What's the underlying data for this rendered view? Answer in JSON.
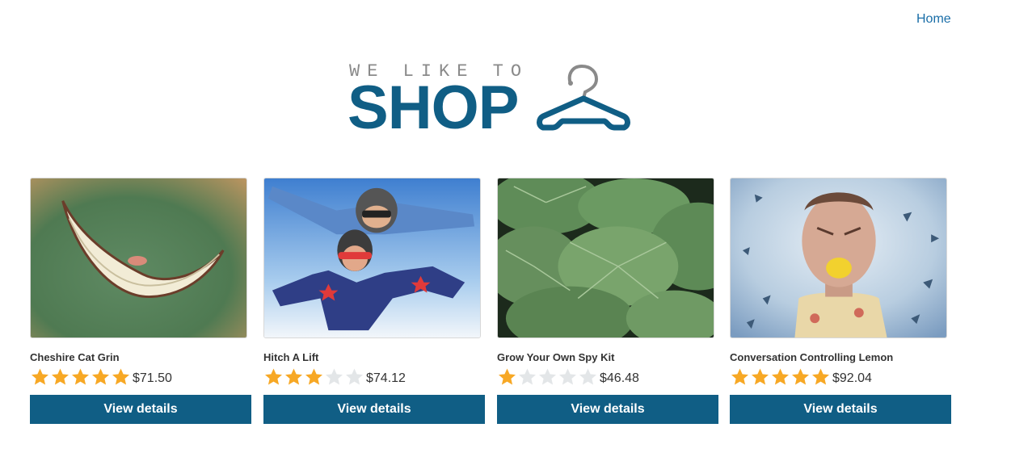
{
  "nav": {
    "home_label": "Home"
  },
  "logo": {
    "tagline": "WE LIKE TO",
    "word": "SHOP",
    "icon": "hanger-icon"
  },
  "colors": {
    "brand": "#105e85",
    "link": "#1a6ea8",
    "star_filled": "#f7a825",
    "star_empty": "#e3e6e8"
  },
  "products": [
    {
      "title": "Cheshire Cat Grin",
      "rating": 5,
      "max_rating": 5,
      "price": "$71.50",
      "button_label": "View details",
      "image": "grinning-mouth-image"
    },
    {
      "title": "Hitch A Lift",
      "rating": 3,
      "max_rating": 5,
      "price": "$74.12",
      "button_label": "View details",
      "image": "skydivers-image"
    },
    {
      "title": "Grow Your Own Spy Kit",
      "rating": 1,
      "max_rating": 5,
      "price": "$46.48",
      "button_label": "View details",
      "image": "leaves-image"
    },
    {
      "title": "Conversation Controlling Lemon",
      "rating": 5,
      "max_rating": 5,
      "price": "$92.04",
      "button_label": "View details",
      "image": "man-with-lemon-image"
    }
  ]
}
